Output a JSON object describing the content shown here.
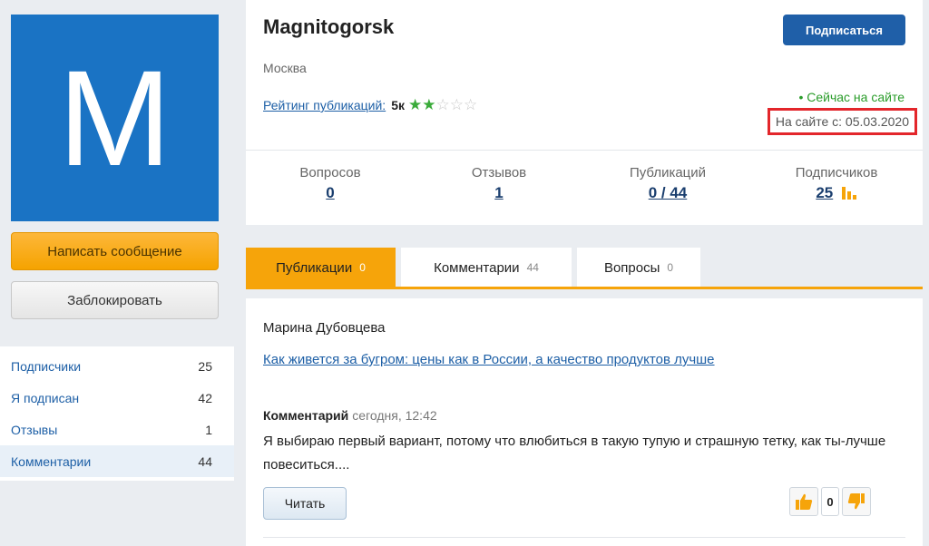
{
  "profile": {
    "avatar_letter": "M",
    "name": "Magnitogorsk",
    "city": "Москва",
    "rating_label": "Рейтинг публикаций:",
    "rating_value": "5к",
    "stars_filled": 2,
    "stars_total": 5,
    "subscribe_label": "Подписаться",
    "online_text": "• Сейчас на сайте",
    "since_text": "На сайте с: 05.03.2020"
  },
  "stats": [
    {
      "label": "Вопросов",
      "value": "0"
    },
    {
      "label": "Отзывов",
      "value": "1"
    },
    {
      "label": "Публикаций",
      "value": "0 / 44"
    },
    {
      "label": "Подписчиков",
      "value": "25"
    }
  ],
  "sidebar": {
    "write_message": "Написать сообщение",
    "block": "Заблокировать",
    "items": [
      {
        "label": "Подписчики",
        "count": "25"
      },
      {
        "label": "Я подписан",
        "count": "42"
      },
      {
        "label": "Отзывы",
        "count": "1"
      },
      {
        "label": "Комментарии",
        "count": "44"
      }
    ]
  },
  "tabs": [
    {
      "label": "Публикации",
      "count": "0"
    },
    {
      "label": "Комментарии",
      "count": "44"
    },
    {
      "label": "Вопросы",
      "count": "0"
    }
  ],
  "feed": {
    "author": "Марина Дубовцева",
    "title": "Как живется за бугром: цены как в России, а качество продуктов лучше",
    "comment_label": "Комментарий",
    "comment_time": "сегодня, 12:42",
    "comment_text": "Я выбираю первый вариант, потому что влюбиться в такую тупую и страшную тетку, как ты-лучше повеситься....",
    "read_label": "Читать",
    "vote_count": "0"
  },
  "colors": {
    "accent": "#f6a40a",
    "brand_blue": "#1f5fa8",
    "avatar_bg": "#1a73c4",
    "highlight_red": "#e3262b",
    "online_green": "#2a9c2a"
  },
  "icons": [
    "thumbs-up-icon",
    "thumbs-down-icon",
    "bar-chart-icon",
    "balloon-icon",
    "star-icon"
  ]
}
